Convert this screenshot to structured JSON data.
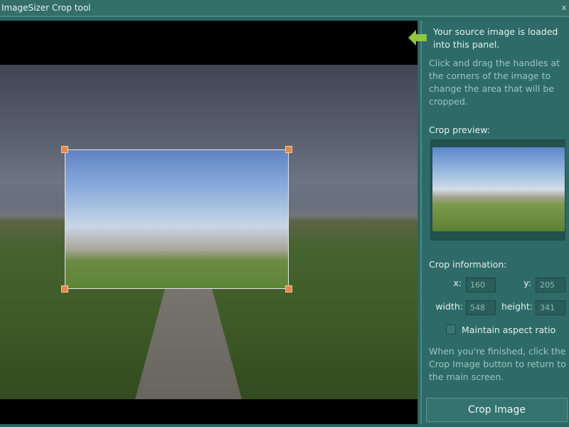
{
  "window": {
    "title": "ImageSizer Crop tool",
    "close": "x"
  },
  "side": {
    "intro": "Your source image is loaded into this panel.",
    "instructions": "Click and drag the handles at the corners of the image to change the area that will be cropped.",
    "preview_label": "Crop preview:",
    "info_label": "Crop information:",
    "x_label": "x:",
    "x_value": "160",
    "y_label": "y:",
    "y_value": "205",
    "width_label": "width:",
    "width_value": "548",
    "height_label": "height:",
    "height_value": "341",
    "aspect_label": "Maintain aspect ratio",
    "aspect_checked": false,
    "finish_text": "When you're finished, click the Crop Image button to return to the main screen.",
    "crop_button": "Crop Image"
  },
  "colors": {
    "accent_arrow": "#8dc63f",
    "handle": "#e08a4a"
  }
}
